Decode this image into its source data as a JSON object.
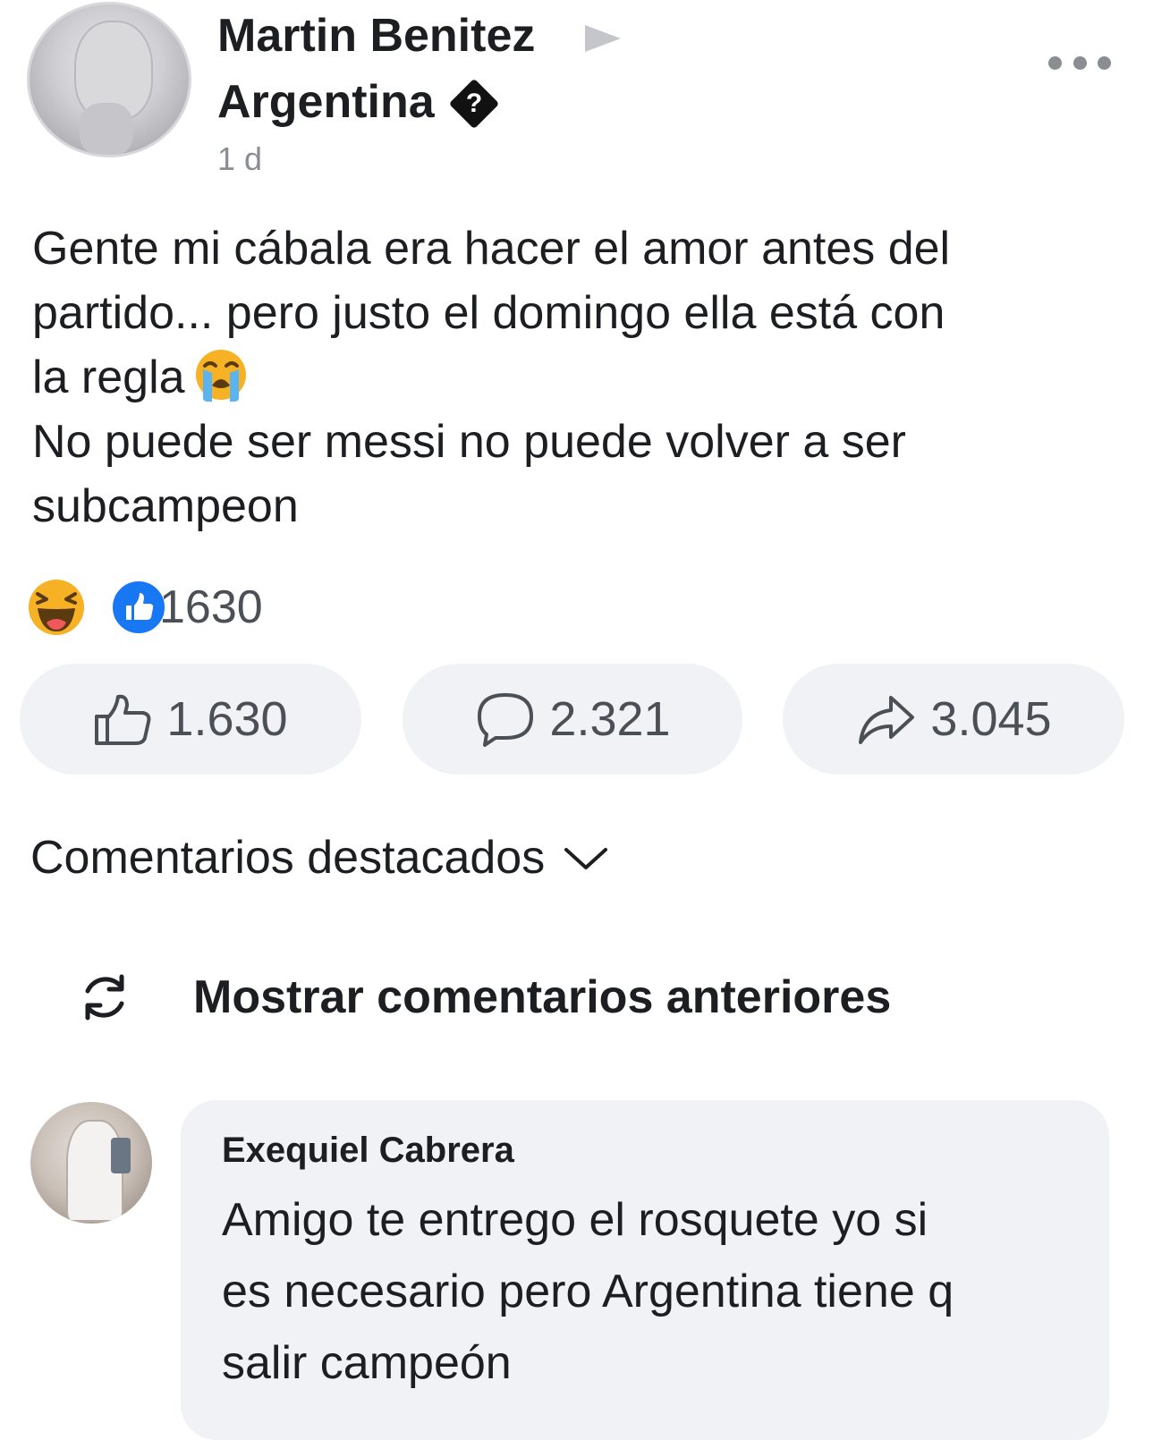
{
  "post": {
    "author": "Martin Benitez",
    "page": "Argentina",
    "badge_glyph": "?",
    "time": "1 d",
    "body_lines": [
      "Gente mi cábala era hacer el amor antes del",
      "partido... pero justo el domingo ella está con",
      "la regla",
      "No puede ser messi no puede volver a ser",
      "subcampeon"
    ],
    "emoji_after_line_3": "crying-face",
    "reactions": {
      "icons": [
        "haha",
        "like"
      ],
      "count": "1630"
    },
    "actions": {
      "likes": "1.630",
      "comments": "2.321",
      "shares": "3.045"
    }
  },
  "comments_section": {
    "sort_label": "Comentarios destacados",
    "show_previous_label": "Mostrar comentarios anteriores",
    "comments": [
      {
        "author": "Exequiel Cabrera",
        "text_lines": [
          "Amigo te entrego el rosquete yo si",
          "es necesario pero Argentina tiene q",
          "salir campeón"
        ]
      }
    ]
  },
  "colors": {
    "text_primary": "#1c1e21",
    "text_secondary": "#8a8d91",
    "button_bg": "#f0f2f5",
    "like_blue": "#1877f2",
    "emoji_yellow": "#f7b125"
  }
}
